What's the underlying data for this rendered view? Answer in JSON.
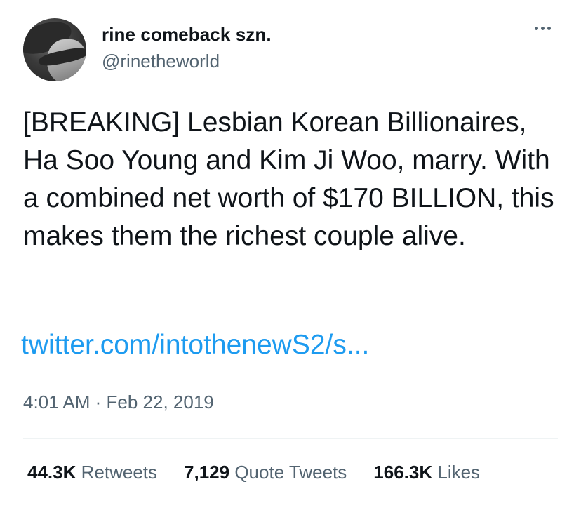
{
  "user": {
    "display_name": "rine comeback szn.",
    "handle": "@rinetheworld"
  },
  "tweet": {
    "text": "[BREAKING] Lesbian Korean Billionaires, Ha Soo Young and Kim Ji Woo, marry. With a combined net worth of $170 BILLION, this makes them the richest couple alive.",
    "link": "twitter.com/intothenewS2/s...",
    "time": "4:01 AM",
    "separator": " · ",
    "date": "Feb 22, 2019"
  },
  "stats": {
    "retweets_count": "44.3K",
    "retweets_label": "Retweets",
    "quotes_count": "7,129",
    "quotes_label": "Quote Tweets",
    "likes_count": "166.3K",
    "likes_label": "Likes"
  },
  "icons": {
    "more": "more-horizontal-icon"
  },
  "colors": {
    "link": "#1d9bf0",
    "secondary_text": "#536471",
    "divider": "#eff3f4"
  }
}
